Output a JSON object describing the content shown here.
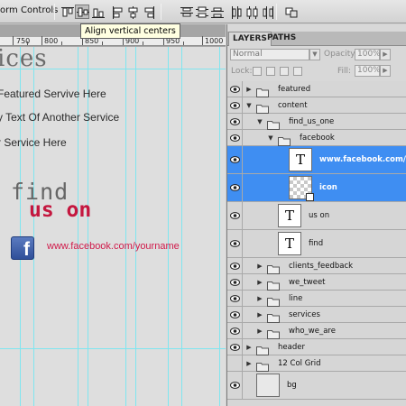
{
  "toolbar": {
    "label": "orm Controls",
    "tooltip": "Align vertical centers"
  },
  "ruler": {
    "labels": [
      "750",
      "800",
      "850",
      "900",
      "950",
      "1000"
    ]
  },
  "document": {
    "title": "ices",
    "services": [
      "Featured Servive Here",
      "y Text Of Another Service",
      "r Service Here"
    ],
    "find_text": "find",
    "us_on_text": "us on",
    "fb_glyph": "f",
    "fb_url": "www.facebook.com/yourname"
  },
  "panel": {
    "tabs": [
      "LAYERS",
      "PATHS"
    ],
    "blend_mode": "Normal",
    "opacity_label": "Opacity:",
    "opacity_value": "100%",
    "lock_label": "Lock:",
    "fill_label": "Fill:",
    "fill_value": "100%",
    "layers": [
      {
        "name": "featured",
        "kind": "folder",
        "depth": 0,
        "expanded": false,
        "visible": true
      },
      {
        "name": "content",
        "kind": "folder",
        "depth": 0,
        "expanded": true,
        "visible": true
      },
      {
        "name": "find_us_one",
        "kind": "folder",
        "depth": 1,
        "expanded": true,
        "visible": true
      },
      {
        "name": "facebook",
        "kind": "folder",
        "depth": 2,
        "expanded": true,
        "visible": true
      },
      {
        "name": "www.facebook.com/yourna",
        "kind": "text",
        "depth": 3,
        "selected": true,
        "visible": true,
        "thumb_glyph": "T"
      },
      {
        "name": "icon",
        "kind": "smart",
        "depth": 3,
        "selected": true,
        "visible": true
      },
      {
        "name": "us on",
        "kind": "text",
        "depth": 2,
        "visible": true,
        "thumb_glyph": "T"
      },
      {
        "name": "find",
        "kind": "text",
        "depth": 2,
        "visible": true,
        "thumb_glyph": "T"
      },
      {
        "name": "clients_feedback",
        "kind": "folder",
        "depth": 1,
        "expanded": false,
        "visible": true
      },
      {
        "name": "we_tweet",
        "kind": "folder",
        "depth": 1,
        "expanded": false,
        "visible": true
      },
      {
        "name": "line",
        "kind": "folder",
        "depth": 1,
        "expanded": false,
        "visible": true
      },
      {
        "name": "services",
        "kind": "folder",
        "depth": 1,
        "expanded": false,
        "visible": true
      },
      {
        "name": "who_we_are",
        "kind": "folder",
        "depth": 1,
        "expanded": false,
        "visible": true
      },
      {
        "name": "header",
        "kind": "folder",
        "depth": 0,
        "expanded": false,
        "visible": true
      },
      {
        "name": "12 Col Grid",
        "kind": "folder",
        "depth": 0,
        "expanded": false,
        "visible": false
      },
      {
        "name": "bg",
        "kind": "pixel",
        "depth": 0,
        "visible": true
      }
    ]
  },
  "colors": {
    "selection": "#3f8ef2",
    "guide": "#7fe6f0",
    "accent_red": "#c4173f",
    "facebook_blue": "#3b5998"
  }
}
